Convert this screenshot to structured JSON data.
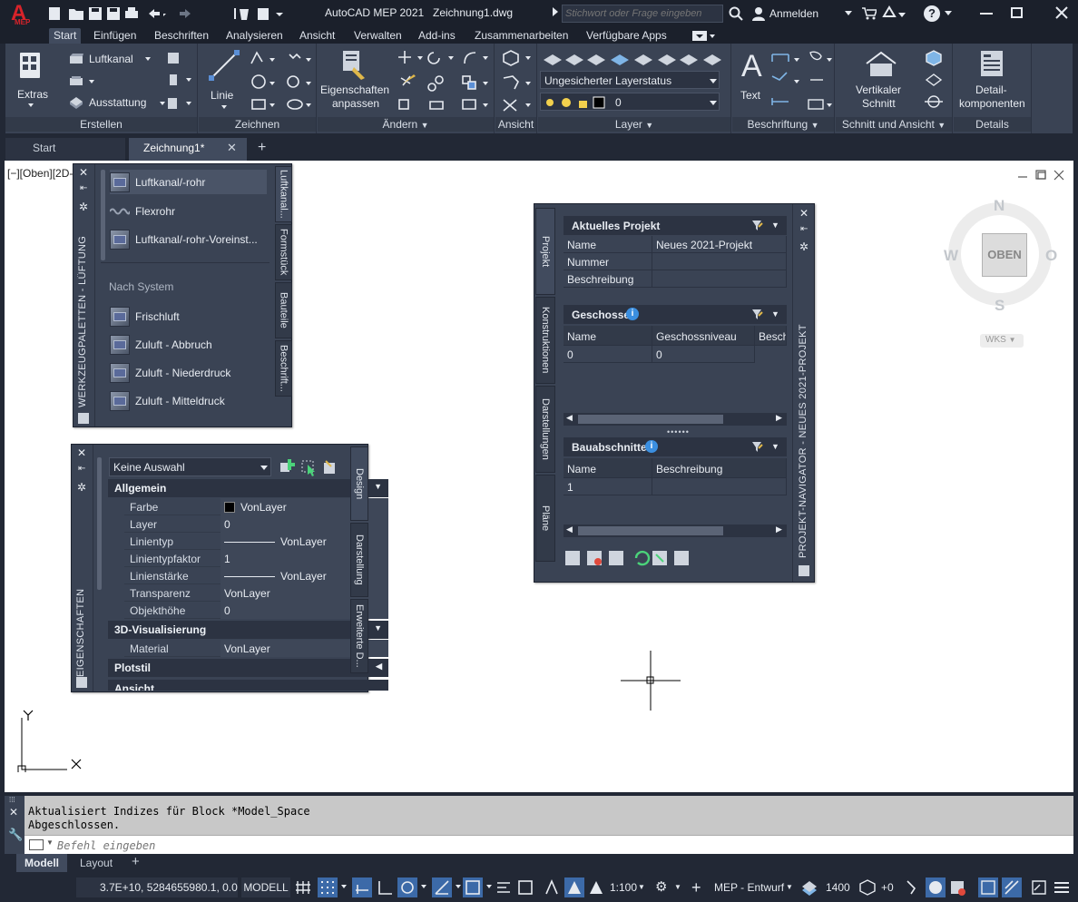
{
  "title_bar": {
    "app_logo": "A",
    "app_badge": "MEP",
    "app_title": "AutoCAD MEP 2021",
    "document": "Zeichnung1.dwg",
    "search_placeholder": "Stichwort oder Frage eingeben",
    "signin": "Anmelden",
    "help": "?"
  },
  "ribbon_tabs": [
    "Start",
    "Einfügen",
    "Beschriften",
    "Analysieren",
    "Ansicht",
    "Verwalten",
    "Add-ins",
    "Zusammenarbeiten",
    "Verfügbare Apps"
  ],
  "ribbon": {
    "extras": "Extras",
    "luftkanal": "Luftkanal",
    "ausstattung": "Ausstattung",
    "erstellen": "Erstellen",
    "linie": "Linie",
    "zeichnen": "Zeichnen",
    "eigenschaften_l1": "Eigenschaften",
    "eigenschaften_l2": "anpassen",
    "aendern": "Ändern",
    "ansicht": "Ansicht",
    "layer_status": "Ungesicherter Layerstatus",
    "layer_current": "0",
    "layer": "Layer",
    "text": "Text",
    "beschriftung": "Beschriftung",
    "vertikaler_l1": "Vertikaler",
    "vertikaler_l2": "Schnitt",
    "schnitt_ansicht": "Schnitt und Ansicht",
    "detail_l1": "Detail-",
    "detail_l2": "komponenten",
    "details": "Details"
  },
  "doc_tabs": {
    "start": "Start",
    "drawing": "Zeichnung1*",
    "add": "+"
  },
  "viewport_label": "[−][Oben][2D-",
  "tool_palette": {
    "title": "WERKZEUGPALETTEN - LÜFTUNG",
    "tabs": [
      "Luftkanal...",
      "Formstück",
      "Bauteile",
      "Beschrift..."
    ],
    "items_top": [
      "Luftkanal/-rohr",
      "Flexrohr",
      "Luftkanal/-rohr-Voreinst..."
    ],
    "section": "Nach System",
    "items_system": [
      "Frischluft",
      "Zuluft - Abbruch",
      "Zuluft - Niederdruck",
      "Zuluft - Mitteldruck"
    ]
  },
  "properties": {
    "title": "EIGENSCHAFTEN",
    "selection": "Keine Auswahl",
    "tabs": [
      "Design",
      "Darstellung",
      "Erweiterte D..."
    ],
    "sec_general": "Allgemein",
    "rows": [
      {
        "k": "Farbe",
        "v": "VonLayer"
      },
      {
        "k": "Layer",
        "v": "0"
      },
      {
        "k": "Linientyp",
        "v": "VonLayer"
      },
      {
        "k": "Linientypfaktor",
        "v": "1"
      },
      {
        "k": "Linienstärke",
        "v": "VonLayer"
      },
      {
        "k": "Transparenz",
        "v": "VonLayer"
      },
      {
        "k": "Objekthöhe",
        "v": "0"
      }
    ],
    "sec_3d": "3D-Visualisierung",
    "material_k": "Material",
    "material_v": "VonLayer",
    "sec_plot": "Plotstil",
    "sec_more": "Ansicht"
  },
  "project_nav": {
    "title": "PROJEKT-NAVIGATOR - NEUES 2021-PROJEKT",
    "tabs": [
      "Projekt",
      "Konstruktionen",
      "Darstellungen",
      "Pläne"
    ],
    "current_project": "Aktuelles Projekt",
    "proj_rows": [
      {
        "k": "Name",
        "v": "Neues 2021-Projekt"
      },
      {
        "k": "Nummer",
        "v": ""
      },
      {
        "k": "Beschreibung",
        "v": ""
      }
    ],
    "levels_title": "Geschosse",
    "levels_cols": [
      "Name",
      "Geschossniveau",
      "Besch"
    ],
    "levels_row": [
      "0",
      "0"
    ],
    "divisions_title": "Bauabschnitte",
    "divisions_cols": [
      "Name",
      "Beschreibung"
    ],
    "divisions_row": [
      "1"
    ]
  },
  "viewcube": {
    "n": "N",
    "s": "S",
    "w": "W",
    "o": "O",
    "face": "OBEN",
    "ucs": "WKS"
  },
  "ucs": {
    "y": "Y",
    "x": "X"
  },
  "command": {
    "line1": "Aktualisiert Indizes für Block *Model_Space",
    "line2": "Abgeschlossen.",
    "placeholder": "Befehl eingeben"
  },
  "layout_tabs": {
    "model": "Modell",
    "layout": "Layout",
    "add": "+"
  },
  "status": {
    "coords": "3.7E+10, 5284655980.1, 0.0",
    "space": "MODELL",
    "scale": "1:100",
    "workspace": "MEP - Entwurf",
    "elevation": "1400",
    "plus0": "+0"
  },
  "colors": {
    "accent": "#3c6aa8",
    "canvas": "#ffffff",
    "chrome": "#222835",
    "panel": "#3a4354",
    "logo": "#d8232a"
  }
}
